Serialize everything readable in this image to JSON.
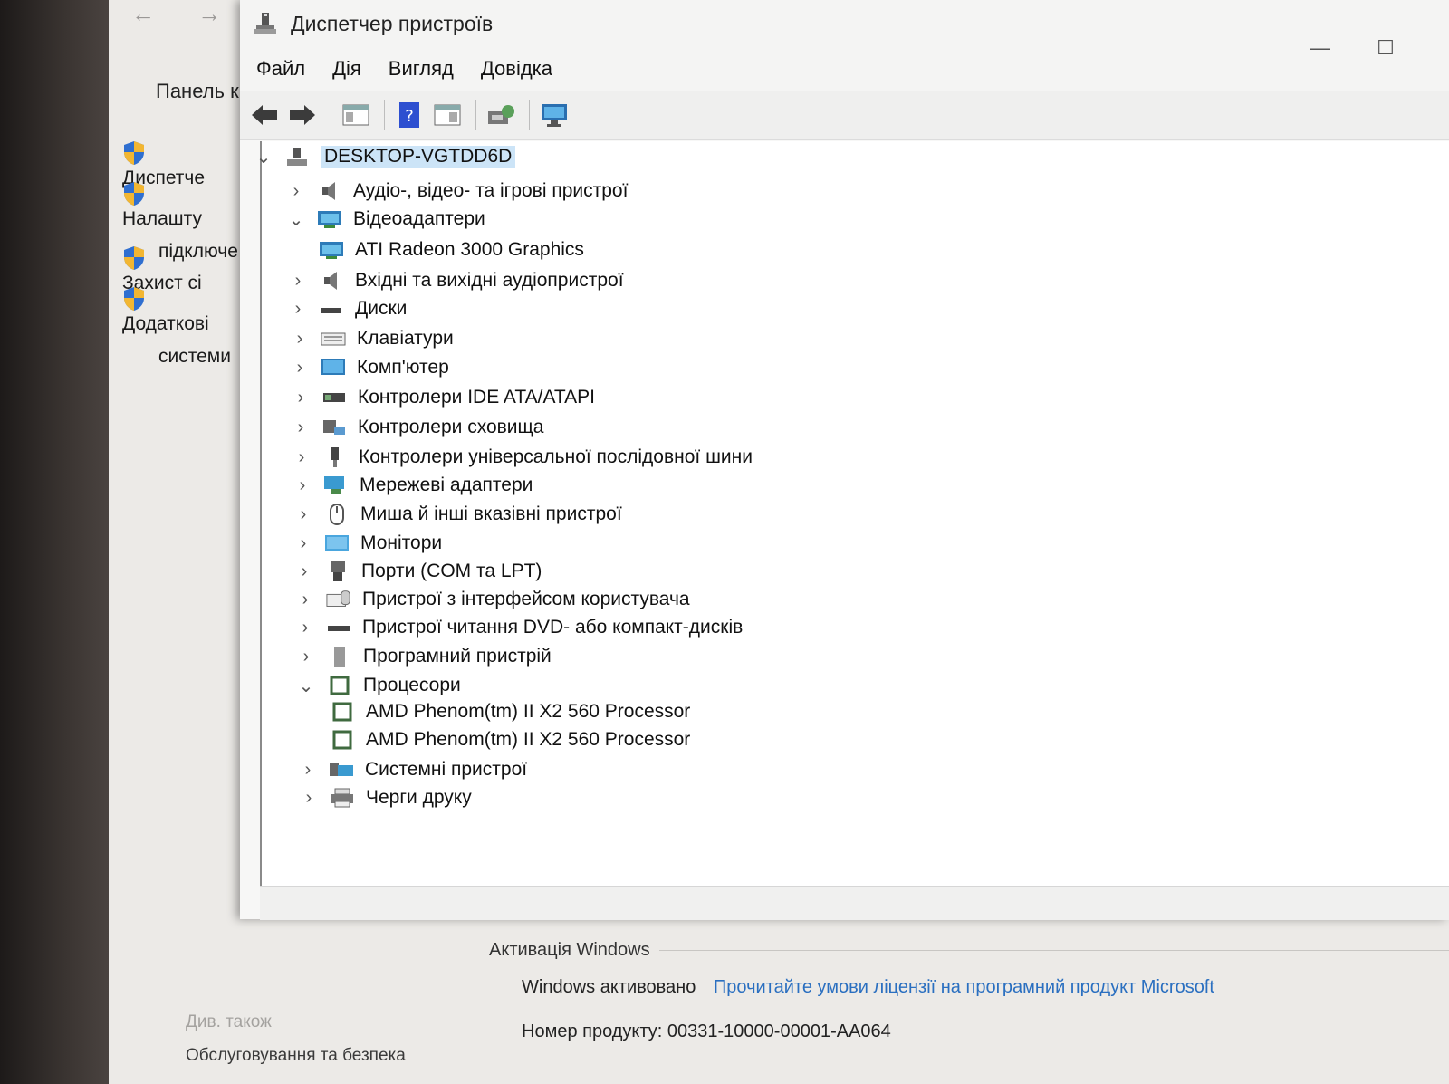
{
  "background_window": {
    "nav_back": "←",
    "nav_forward": "→",
    "panel_title": "Панель к",
    "links": [
      {
        "label": "Диспетче"
      },
      {
        "label": "Налашту",
        "label2": "підключе"
      },
      {
        "label": "Захист сі"
      },
      {
        "label": "Додаткові",
        "label2": "системи"
      }
    ],
    "see_also": "Див. також",
    "service_security": "Обслуговування та безпека",
    "activation": {
      "header": "Активація Windows",
      "status": "Windows активовано",
      "license_link": "Прочитайте умови ліцензії на програмний продукт Microsoft",
      "product_id_label": "Номер продукту:",
      "product_id": "00331-10000-00001-AA064"
    }
  },
  "device_manager": {
    "title": "Диспетчер пристроїв",
    "minimize": "—",
    "maximize": "☐",
    "menu": [
      "Файл",
      "Дія",
      "Вигляд",
      "Довідка"
    ],
    "tree": {
      "root": "DESKTOP-VGTDD6D",
      "nodes": [
        {
          "label": "Аудіо-, відео- та ігрові пристрої",
          "expanded": false,
          "icon": "speaker-icon"
        },
        {
          "label": "Відеоадаптери",
          "expanded": true,
          "icon": "display-adapter-icon"
        },
        {
          "label": "ATI Radeon 3000 Graphics",
          "child": true,
          "icon": "display-adapter-icon"
        },
        {
          "label": "Вхідні та вихідні аудіопристрої",
          "expanded": false,
          "icon": "speaker-icon"
        },
        {
          "label": "Диски",
          "expanded": false,
          "icon": "disk-icon"
        },
        {
          "label": "Клавіатури",
          "expanded": false,
          "icon": "keyboard-icon"
        },
        {
          "label": "Комп'ютер",
          "expanded": false,
          "icon": "computer-icon"
        },
        {
          "label": "Контролери IDE ATA/ATAPI",
          "expanded": false,
          "icon": "ide-controller-icon"
        },
        {
          "label": "Контролери сховища",
          "expanded": false,
          "icon": "storage-controller-icon"
        },
        {
          "label": "Контролери універсальної послідовної шини",
          "expanded": false,
          "icon": "usb-icon"
        },
        {
          "label": "Мережеві адаптери",
          "expanded": false,
          "icon": "network-adapter-icon"
        },
        {
          "label": "Миша й інші вказівні пристрої",
          "expanded": false,
          "icon": "mouse-icon"
        },
        {
          "label": "Монітори",
          "expanded": false,
          "icon": "monitor-icon"
        },
        {
          "label": "Порти (COM та LPT)",
          "expanded": false,
          "icon": "port-icon"
        },
        {
          "label": "Пристрої з інтерфейсом користувача",
          "expanded": false,
          "icon": "hid-icon"
        },
        {
          "label": "Пристрої читання DVD- або компакт-дисків",
          "expanded": false,
          "icon": "dvd-drive-icon"
        },
        {
          "label": "Програмний пристрій",
          "expanded": false,
          "icon": "software-device-icon"
        },
        {
          "label": "Процесори",
          "expanded": true,
          "icon": "processor-icon"
        },
        {
          "label": "AMD Phenom(tm) II X2 560 Processor",
          "child": true,
          "icon": "processor-icon"
        },
        {
          "label": "AMD Phenom(tm) II X2 560 Processor",
          "child": true,
          "icon": "processor-icon"
        },
        {
          "label": "Системні пристрої",
          "expanded": false,
          "icon": "system-devices-icon"
        },
        {
          "label": "Черги друку",
          "expanded": false,
          "icon": "printer-icon"
        }
      ]
    },
    "chevron_collapsed": "›",
    "chevron_expanded": "⌄"
  },
  "colors": {
    "selection": "#cce4f7",
    "link": "#2a6fc0",
    "shield_blue": "#2f6fd0",
    "shield_yellow": "#f2b632"
  }
}
